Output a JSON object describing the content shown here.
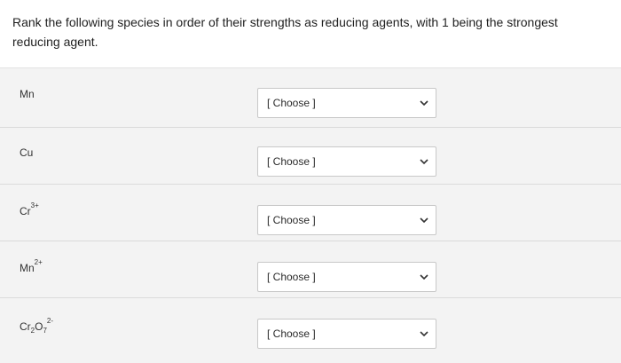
{
  "question": {
    "text": "Rank the following species in order of their strengths as reducing agents, with 1 being the strongest reducing agent."
  },
  "rows": [
    {
      "label_main": "Mn",
      "label_sup": "",
      "select_value": "[ Choose ]"
    },
    {
      "label_main": "Cu",
      "label_sup": "",
      "select_value": "[ Choose ]"
    },
    {
      "label_main": "Cr",
      "label_sup": "3+",
      "select_value": "[ Choose ]"
    },
    {
      "label_main": "Mn",
      "label_sup": "2+",
      "select_value": "[ Choose ]"
    },
    {
      "label_main": "Cr",
      "label_sub1": "2",
      "label_mid": "O",
      "label_sub2": "7",
      "label_sup": "2-",
      "select_value": "[ Choose ]"
    }
  ],
  "icons": {
    "dropdown": "chevron-down-icon"
  }
}
